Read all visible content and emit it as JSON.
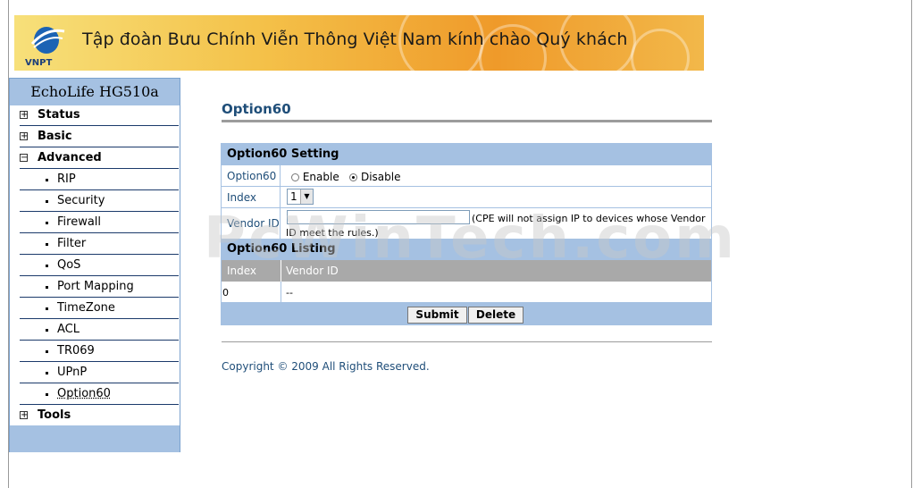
{
  "banner": {
    "logo_text": "VNPT",
    "greeting": "Tập đoàn Bưu Chính Viễn Thông Việt Nam kính chào Quý khách"
  },
  "nav": {
    "title": "EchoLife HG510a",
    "top_items": [
      {
        "label": "Status",
        "expander": "+"
      },
      {
        "label": "Basic",
        "expander": "+"
      },
      {
        "label": "Advanced",
        "expander": "−"
      },
      {
        "label": "Tools",
        "expander": "+"
      }
    ],
    "advanced_items": [
      "RIP",
      "Security",
      "Firewall",
      "Filter",
      "QoS",
      "Port Mapping",
      "TimeZone",
      "ACL",
      "TR069",
      "UPnP",
      "Option60"
    ],
    "selected": "Option60"
  },
  "main": {
    "page_title": "Option60",
    "setting": {
      "header": "Option60 Setting",
      "option60_label": "Option60",
      "enable_label": "Enable",
      "disable_label": "Disable",
      "selected_mode": "Disable",
      "index_label": "Index",
      "index_value": "1",
      "vendor_label": "Vendor ID",
      "vendor_value": "",
      "vendor_hint": "(CPE will not assign IP to devices whose Vendor ID meet the rules.)"
    },
    "listing": {
      "header": "Option60 Listing",
      "columns": [
        "Index",
        "Vendor ID"
      ],
      "rows": [
        [
          "0",
          "--"
        ]
      ]
    },
    "buttons": {
      "submit": "Submit",
      "delete": "Delete"
    },
    "copyright": "Copyright © 2009 All Rights Reserved."
  },
  "watermark": "PcWinTech.com",
  "colors": {
    "nav_blue": "#a5c1e2",
    "title_blue": "#1f4e79",
    "list_head_grey": "#a9a9a9"
  }
}
